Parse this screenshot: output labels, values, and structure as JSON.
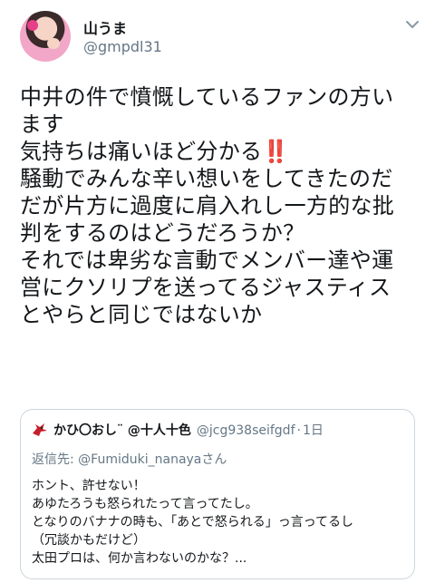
{
  "tweet": {
    "display_name": "山うま",
    "handle": "@gmpdl31",
    "text_lines": [
      "中井の件で憤慨しているファンの方い",
      "ます",
      "気持ちは痛いほど分かる",
      "騒動でみんな辛い想いをしてきたのだ",
      "だが片方に過度に肩入れし一方的な批",
      "判をするのはどうだろうか？",
      "それでは卑劣な言動でメンバー達や運",
      "営にクソリプを送ってるジャスティス",
      "とやらと同じではないか"
    ],
    "emoji_bangbang": "‼️"
  },
  "quoted": {
    "display_name": "かひ〇おし¨ @十人十色",
    "handle": "@jcg938seifgdf",
    "separator": "·",
    "time": "1日",
    "reply_prefix": "返信先: ",
    "reply_to": "@Fumiduki_nanaya",
    "reply_suffix": "さん",
    "text_lines": [
      "ホント、許せない！",
      "あゆたろうも怒られたって言ってたし。",
      "となりのバナナの時も、「あとで怒られる」っ言ってるし",
      "（冗談かもだけど）",
      "太田プロは、何か言わないのかな？..."
    ]
  },
  "icons": {
    "avatar": "profile-photo",
    "menu": "chevron-down-icon",
    "quoted_avatar": "bird-emoji-icon"
  },
  "colors": {
    "text": "#14171a",
    "muted": "#657786",
    "border": "#ccd6dd",
    "emoji_red": "#e0245e"
  }
}
